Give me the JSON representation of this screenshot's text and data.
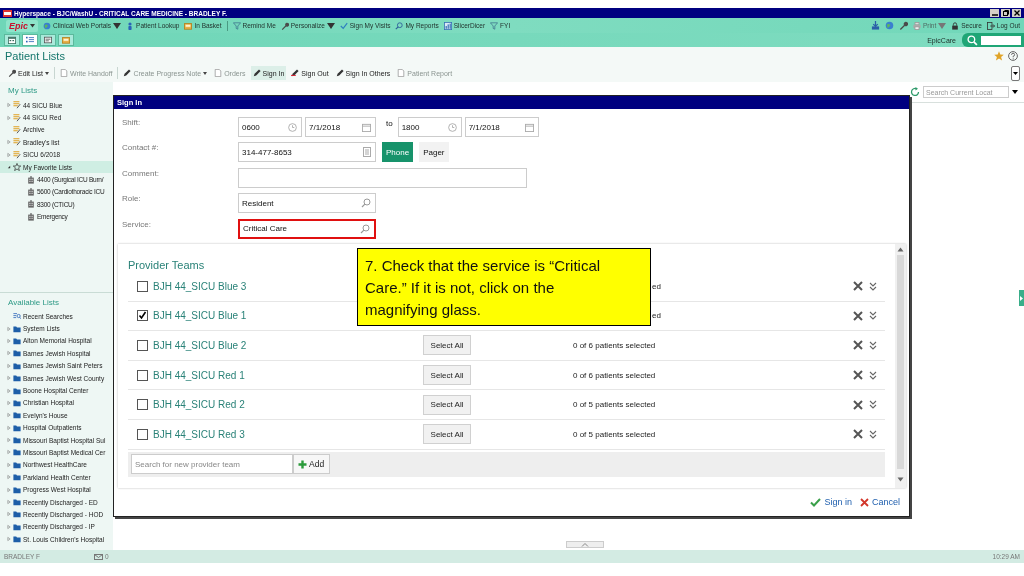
{
  "window": {
    "title": "Hyperspace - BJC/WashU - CRITICAL CARE MEDICINE - BRADLEY F."
  },
  "main_toolbar": {
    "logo": "Epic",
    "items": [
      {
        "label": "Clinical Web Portals",
        "dropdown": true,
        "disabled": false
      },
      {
        "label": "Patient Lookup",
        "dropdown": false,
        "disabled": false
      },
      {
        "label": "In Basket",
        "dropdown": false,
        "disabled": false
      },
      {
        "label": "Remind Me",
        "dropdown": false,
        "disabled": false
      },
      {
        "label": "Personalize",
        "dropdown": true,
        "disabled": false
      },
      {
        "label": "Sign My Visits",
        "dropdown": false,
        "disabled": false
      },
      {
        "label": "My Reports",
        "dropdown": false,
        "disabled": false
      },
      {
        "label": "SlicerDicer",
        "dropdown": false,
        "disabled": false
      },
      {
        "label": "FYI",
        "dropdown": false,
        "disabled": false
      }
    ],
    "right_items": [
      {
        "label": "Print",
        "dropdown": true,
        "disabled": true
      },
      {
        "label": "Secure",
        "dropdown": false,
        "disabled": false
      },
      {
        "label": "Log Out",
        "dropdown": false,
        "disabled": false
      }
    ]
  },
  "secondary_toolbar": {
    "tabs": [
      {
        "selected": false
      },
      {
        "selected": true
      },
      {
        "selected": false
      },
      {
        "selected": false
      }
    ],
    "search_label": "EpicCare"
  },
  "activity": {
    "title": "Patient Lists"
  },
  "actions": [
    {
      "label": "Edit List",
      "dropdown": true,
      "disabled": false,
      "selected": false
    },
    {
      "label": "Write Handoff",
      "dropdown": false,
      "disabled": true,
      "selected": false
    },
    {
      "label": "Create Progress Note",
      "dropdown": true,
      "disabled": true,
      "selected": false
    },
    {
      "label": "Orders",
      "dropdown": false,
      "disabled": true,
      "selected": false
    },
    {
      "label": "Sign In",
      "dropdown": false,
      "disabled": false,
      "selected": true
    },
    {
      "label": "Sign Out",
      "dropdown": false,
      "disabled": false,
      "selected": false
    },
    {
      "label": "Sign In Others",
      "dropdown": false,
      "disabled": false,
      "selected": false
    },
    {
      "label": "Patient Report",
      "dropdown": false,
      "disabled": true,
      "selected": false
    }
  ],
  "sidebar": {
    "my_lists": {
      "title": "My Lists",
      "items": [
        {
          "label": "44 SICU Blue",
          "kind": "list",
          "expandable": true,
          "expanded": false,
          "selected": false
        },
        {
          "label": "44 SICU Red",
          "kind": "list",
          "expandable": true,
          "expanded": false,
          "selected": false
        },
        {
          "label": "Archive",
          "kind": "list",
          "expandable": false,
          "selected": false
        },
        {
          "label": "Bradley's list",
          "kind": "list",
          "expandable": true,
          "expanded": false,
          "selected": false
        },
        {
          "label": "SICU 6/2018",
          "kind": "list",
          "expandable": true,
          "expanded": false,
          "selected": false
        },
        {
          "label": "My Favorite Lists",
          "kind": "star",
          "expandable": true,
          "expanded": true,
          "selected": true,
          "children": [
            {
              "label": "4400 (Surgical ICU Burn/",
              "kind": "unit",
              "expandable": false,
              "selected": false
            },
            {
              "label": "5600 (Cardiothoracic ICU",
              "kind": "unit",
              "expandable": false,
              "selected": false
            },
            {
              "label": "8300 (CTICU)",
              "kind": "unit",
              "expandable": false,
              "selected": false
            },
            {
              "label": "Emergency",
              "kind": "unit",
              "expandable": false,
              "selected": false
            }
          ]
        }
      ]
    },
    "available_lists": {
      "title": "Available Lists",
      "items": [
        {
          "label": "Recent Searches",
          "kind": "search",
          "expandable": false,
          "selected": false
        },
        {
          "label": "System Lists",
          "kind": "folder",
          "expandable": true,
          "expanded": false,
          "selected": false
        },
        {
          "label": "Alton Memorial Hospital",
          "kind": "folder",
          "expandable": true,
          "expanded": false,
          "selected": false
        },
        {
          "label": "Barnes Jewish Hospital",
          "kind": "folder",
          "expandable": true,
          "expanded": false,
          "selected": false
        },
        {
          "label": "Barnes Jewish Saint Peters",
          "kind": "folder",
          "expandable": true,
          "expanded": false,
          "selected": false
        },
        {
          "label": "Barnes Jewish West County",
          "kind": "folder",
          "expandable": true,
          "expanded": false,
          "selected": false
        },
        {
          "label": "Boone Hospital Center",
          "kind": "folder",
          "expandable": true,
          "expanded": false,
          "selected": false
        },
        {
          "label": "Christian Hospital",
          "kind": "folder",
          "expandable": true,
          "expanded": false,
          "selected": false
        },
        {
          "label": "Evelyn's House",
          "kind": "folder",
          "expandable": true,
          "expanded": false,
          "selected": false
        },
        {
          "label": "Hospital Outpatients",
          "kind": "folder",
          "expandable": true,
          "expanded": false,
          "selected": false
        },
        {
          "label": "Missouri Baptist Hospital Sul",
          "kind": "folder",
          "expandable": true,
          "expanded": false,
          "selected": false
        },
        {
          "label": "Missouri Baptist Medical Cer",
          "kind": "folder",
          "expandable": true,
          "expanded": false,
          "selected": false
        },
        {
          "label": "Northwest HealthCare",
          "kind": "folder",
          "expandable": true,
          "expanded": false,
          "selected": false
        },
        {
          "label": "Parkland Health Center",
          "kind": "folder",
          "expandable": true,
          "expanded": false,
          "selected": false
        },
        {
          "label": "Progress West Hospital",
          "kind": "folder",
          "expandable": true,
          "expanded": false,
          "selected": false
        },
        {
          "label": "Recently Discharged - ED",
          "kind": "folder",
          "expandable": true,
          "expanded": false,
          "selected": false
        },
        {
          "label": "Recently Discharged - HOD",
          "kind": "folder",
          "expandable": true,
          "expanded": false,
          "selected": false
        },
        {
          "label": "Recently Discharged - IP",
          "kind": "folder",
          "expandable": true,
          "expanded": false,
          "selected": false
        },
        {
          "label": "St. Louis Children's Hospital",
          "kind": "folder",
          "expandable": true,
          "expanded": false,
          "selected": false
        }
      ]
    }
  },
  "list_view": {
    "search": {
      "placeholder": "Search Current Locat"
    }
  },
  "dialog": {
    "title": "Sign In",
    "shift": {
      "label": "Shift:",
      "start_time": "0600",
      "start_date": "7/1/2018",
      "to": "to",
      "end_time": "1800",
      "end_date": "7/1/2018"
    },
    "contact": {
      "label": "Contact #:",
      "value": "314-477-8653",
      "types": [
        {
          "label": "Phone",
          "selected": true
        },
        {
          "label": "Pager",
          "selected": false
        }
      ]
    },
    "comment": {
      "label": "Comment:"
    },
    "role": {
      "label": "Role:",
      "value": "Resident"
    },
    "service": {
      "label": "Service:",
      "value": "Critical Care",
      "highlighted": true
    },
    "provider_teams": {
      "title": "Provider Teams",
      "teams": [
        {
          "name": "BJH 44_SICU Blue 3",
          "checked": false,
          "count": "ed",
          "count_covered": true
        },
        {
          "name": "BJH 44_SICU Blue 1",
          "checked": true,
          "count": "ed",
          "count_covered": true
        },
        {
          "name": "BJH 44_SICU Blue 2",
          "checked": false,
          "select_all": "Select All",
          "count": "0 of 6 patients selected"
        },
        {
          "name": "BJH 44_SICU Red 1",
          "checked": false,
          "select_all": "Select All",
          "count": "0 of 6 patients selected"
        },
        {
          "name": "BJH 44_SICU Red 2",
          "checked": false,
          "select_all": "Select All",
          "count": "0 of 5 patients selected"
        },
        {
          "name": "BJH 44_SICU Red 3",
          "checked": false,
          "select_all": "Select All",
          "count": "0 of 5 patients selected"
        }
      ],
      "search": {
        "placeholder": "Search for new provider team"
      },
      "add_button": "Add"
    },
    "buttons": [
      {
        "label": "Sign in",
        "kind": "confirm"
      },
      {
        "label": "Cancel",
        "kind": "cancel"
      }
    ]
  },
  "callout": {
    "text": "7. Check that the service is “Critical Care.”  If it is not, click on the magnifying glass."
  },
  "status_bar": {
    "user": "BRADLEY F",
    "messages": "0",
    "time": "10:29 AM"
  }
}
